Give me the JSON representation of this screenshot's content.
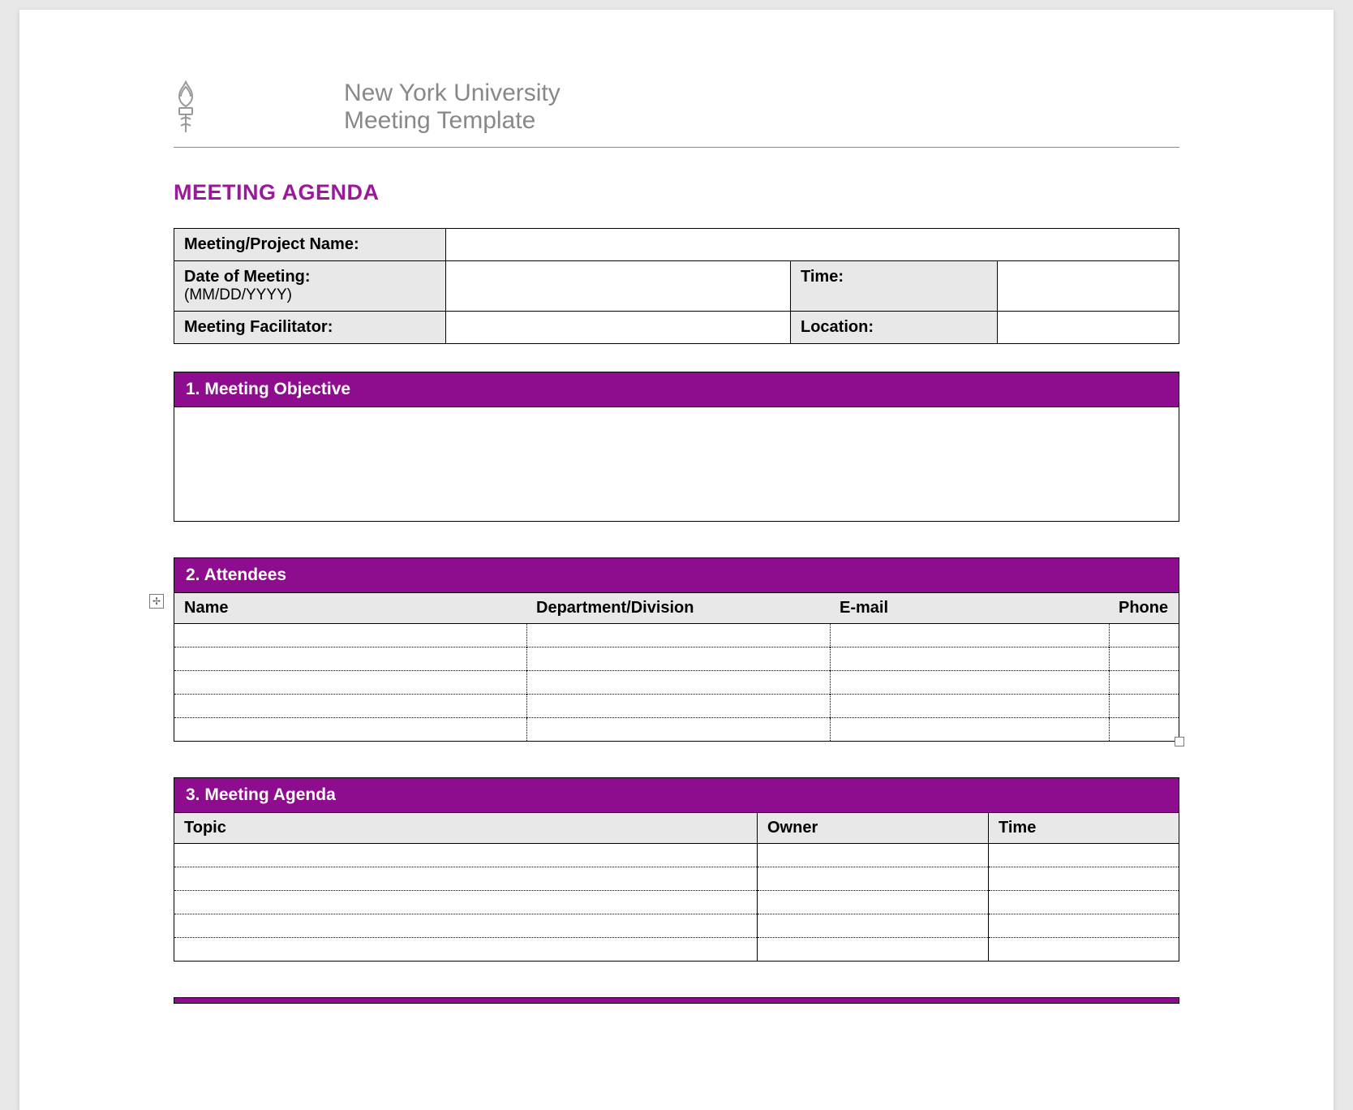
{
  "header": {
    "line1": "New York University",
    "line2": "Meeting Template"
  },
  "agenda_title": "MEETING AGENDA",
  "meta": {
    "project_label": "Meeting/Project Name:",
    "project_value": "",
    "date_label": "Date of Meeting:",
    "date_sub": "(MM/DD/YYYY)",
    "date_value": "",
    "time_label": "Time:",
    "time_value": "",
    "facilitator_label": "Meeting Facilitator:",
    "facilitator_value": "",
    "location_label": "Location:",
    "location_value": ""
  },
  "sections": {
    "objective": "1. Meeting Objective",
    "attendees": "2. Attendees",
    "agenda": "3. Meeting Agenda"
  },
  "attendees_cols": {
    "name": "Name",
    "dept": "Department/Division",
    "email": "E-mail",
    "phone": "Phone"
  },
  "agenda_cols": {
    "topic": "Topic",
    "owner": "Owner",
    "time": "Time"
  },
  "anchor_glyph": "✢"
}
